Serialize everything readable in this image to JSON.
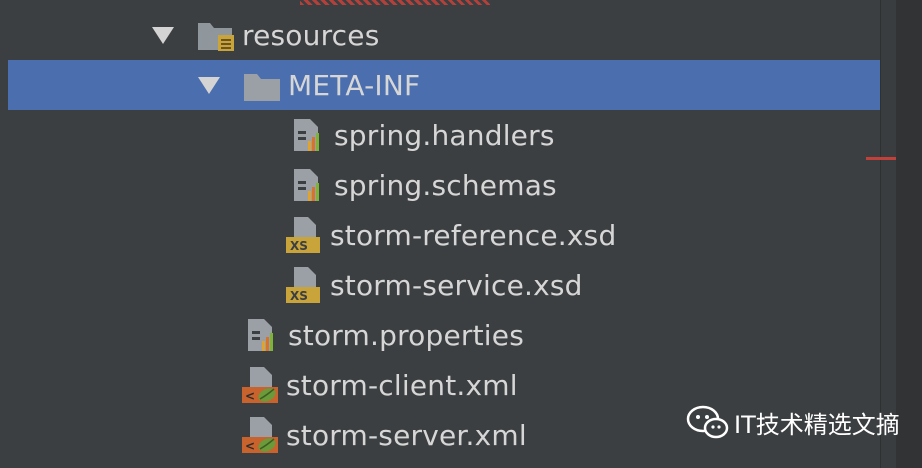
{
  "tree": {
    "rows": [
      {
        "label": "resources",
        "icon": "resources-folder-icon",
        "expanded": true
      },
      {
        "label": "META-INF",
        "icon": "folder-icon",
        "expanded": true,
        "selected": true
      },
      {
        "label": "spring.handlers",
        "icon": "properties-file-icon"
      },
      {
        "label": "spring.schemas",
        "icon": "properties-file-icon"
      },
      {
        "label": "storm-reference.xsd",
        "icon": "xsd-file-icon"
      },
      {
        "label": "storm-service.xsd",
        "icon": "xsd-file-icon"
      },
      {
        "label": "storm.properties",
        "icon": "properties-file-icon"
      },
      {
        "label": "storm-client.xml",
        "icon": "spring-xml-file-icon"
      },
      {
        "label": "storm-server.xml",
        "icon": "spring-xml-file-icon"
      }
    ]
  },
  "watermark": {
    "text": "IT技术精选文摘",
    "icon": "wechat-icon"
  },
  "colors": {
    "background": "#3c3f41",
    "selection": "#4b6eaf",
    "text": "#d6d6d6",
    "xsd_badge": "#c9a43b",
    "xml_badge": "#c8632d",
    "spring_leaf": "#6a9a3a"
  }
}
